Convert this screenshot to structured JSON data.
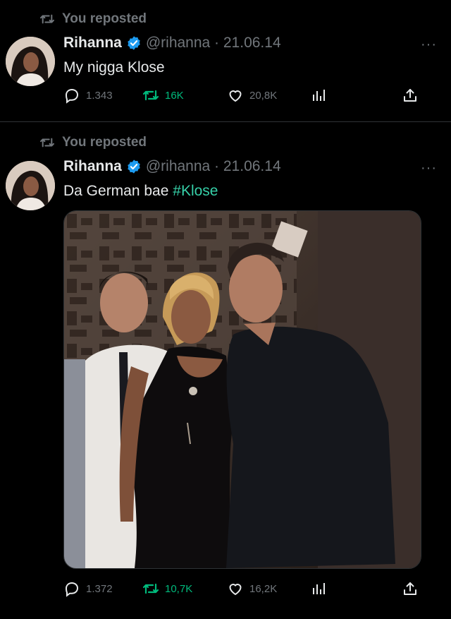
{
  "tweets": [
    {
      "repost_label": "You reposted",
      "display_name": "Rihanna",
      "handle_date": "@rihanna · 21.06.14",
      "text": "My nigga Klose",
      "replies": "1.343",
      "reposts": "16K",
      "likes": "20,8K",
      "more": "···"
    },
    {
      "repost_label": "You reposted",
      "display_name": "Rihanna",
      "handle_date": "@rihanna · 21.06.14",
      "text": "Da German bae",
      "hashtag": "#Klose",
      "replies": "1.372",
      "reposts": "10,7K",
      "likes": "16,2K",
      "more": "···"
    }
  ],
  "colors": {
    "background": "#000000",
    "text": "#e7e9ea",
    "muted": "#71767b",
    "verified": "#1d9bf0",
    "repost": "#00ba7c",
    "hashtag": "#36d0a8"
  },
  "icons": [
    "repost-icon",
    "verified-icon",
    "more-icon",
    "reply-icon",
    "like-icon",
    "views-icon",
    "share-icon"
  ]
}
